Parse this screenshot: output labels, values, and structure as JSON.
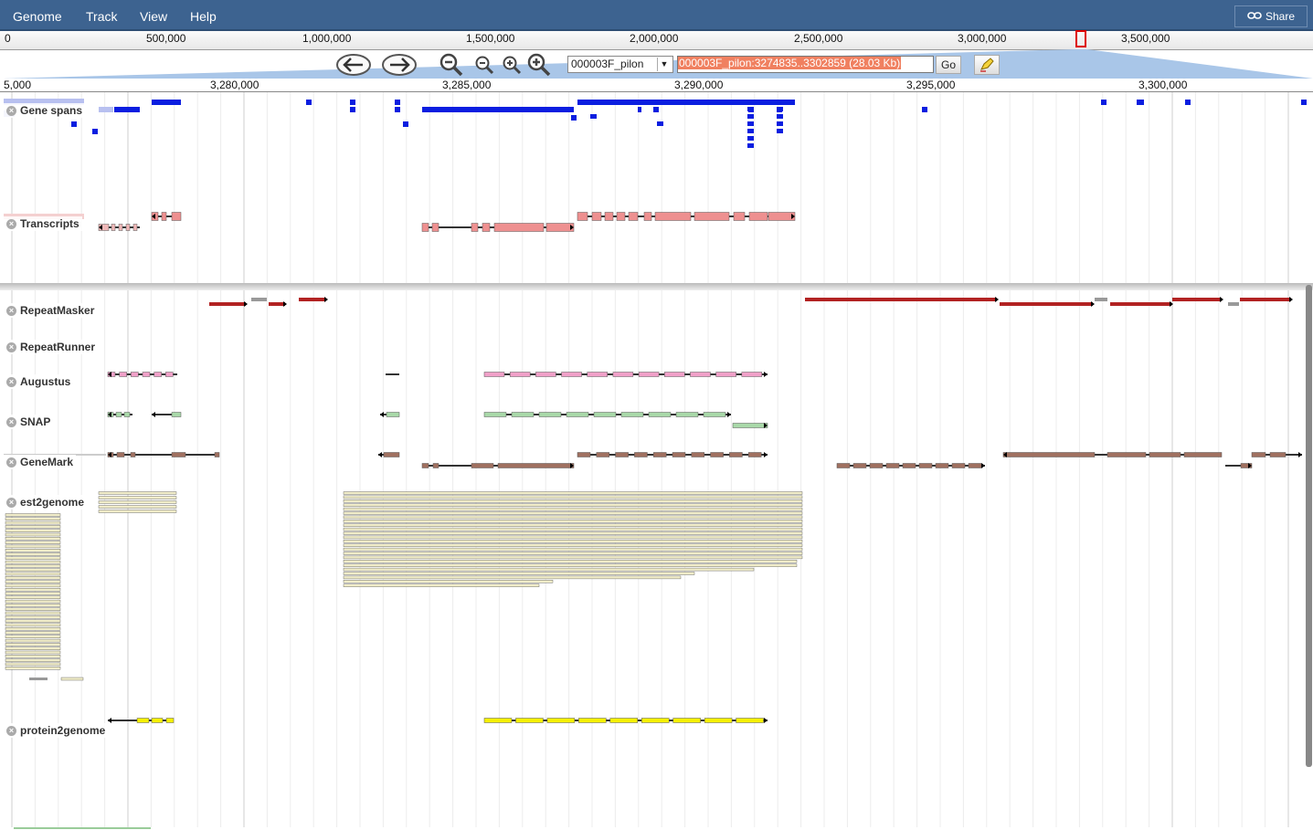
{
  "menubar": {
    "items": [
      "Genome",
      "Track",
      "View",
      "Help"
    ],
    "share_label": "Share"
  },
  "overview": {
    "ticks": [
      "0",
      "500,000",
      "1,000,000",
      "1,500,000",
      "2,000,000",
      "2,500,000",
      "3,000,000",
      "3,500,000"
    ]
  },
  "navigation": {
    "ref_seq": "000003F_pilon",
    "location": "000003F_pilon:3274835..3302859 (28.03 Kb)",
    "go_label": "Go"
  },
  "scale": {
    "ticks": [
      "5,000",
      "3,280,000",
      "3,285,000",
      "3,290,000",
      "3,295,000",
      "3,300,000"
    ]
  },
  "tracks": [
    {
      "name": "Gene spans",
      "color": "#0a1ee0"
    },
    {
      "name": "Transcripts",
      "color": "#ee9090"
    },
    {
      "name": "RepeatMasker",
      "color": "#b22222"
    },
    {
      "name": "RepeatRunner",
      "color": "#b22222"
    },
    {
      "name": "Augustus",
      "color": "#f0a0c8"
    },
    {
      "name": "SNAP",
      "color": "#a8d8a8"
    },
    {
      "name": "GeneMark",
      "color": "#a07060"
    },
    {
      "name": "est2genome",
      "color": "#f0ecc8"
    },
    {
      "name": "protein2genome",
      "color": "#f5f000"
    }
  ],
  "colors": {
    "menubar": "#3d6390",
    "highlight": "#f08060",
    "viewport_marker": "#dd0000"
  }
}
